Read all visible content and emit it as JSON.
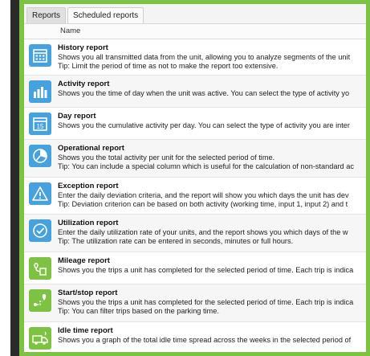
{
  "tabs": [
    {
      "label": "Reports",
      "active": true
    },
    {
      "label": "Scheduled reports",
      "active": false
    }
  ],
  "table": {
    "column_header": "Name"
  },
  "colors": {
    "accent_green": "#7dc242",
    "icon_blue": "#45a2de"
  },
  "reports": [
    {
      "title": "History report",
      "icon": "calendar-icon",
      "icon_color": "blue",
      "description": "Shows you all transmitted data from the unit, allowing you to analyze segments of the unit",
      "tip": "Tip: Limit the period of time as not to make the report too extensive."
    },
    {
      "title": "Activity report",
      "icon": "bar-chart-icon",
      "icon_color": "blue",
      "description": "Shows you the time of day when the unit was active. You can select the type of activity yo",
      "tip": ""
    },
    {
      "title": "Day report",
      "icon": "calendar-day-icon",
      "icon_color": "blue",
      "description": "Shows you the cumulative activity per day. You can select the type of activity you are inter",
      "tip": ""
    },
    {
      "title": "Operational report",
      "icon": "pie-chart-icon",
      "icon_color": "blue",
      "description": "Shows you the total activity per unit for the selected period of time.",
      "tip": "Tip: You can include a special column which is useful for the calculation of non-standard ac"
    },
    {
      "title": "Exception report",
      "icon": "warning-icon",
      "icon_color": "blue",
      "description": "Enter the daily deviation criteria, and the report will show you which days the unit has dev",
      "tip": "Tip: Deviation criterion can be based on both activity (working time, input 1, input 2) and t"
    },
    {
      "title": "Utilization report",
      "icon": "check-circle-icon",
      "icon_color": "blue",
      "description": "Enter the daily utilization rate of your units, and the report shows you which days of the w",
      "tip": "Tip: The utilization rate can be entered in seconds, minutes or full hours."
    },
    {
      "title": "Mileage report",
      "icon": "route-icon",
      "icon_color": "green",
      "description": "Shows you the trips a unit has completed for the selected period of time. Each trip is indica",
      "tip": ""
    },
    {
      "title": "Start/stop report",
      "icon": "start-stop-pin-icon",
      "icon_color": "green",
      "description": "Shows you the trips a unit has completed for the selected period of time. Each trip is indica",
      "tip": "Tip: You can filter trips based on the parking time."
    },
    {
      "title": "Idle time report",
      "icon": "truck-icon",
      "icon_color": "green",
      "description": "Shows you a graph of the total idle time spread across the weeks in the selected period of",
      "tip": ""
    }
  ]
}
